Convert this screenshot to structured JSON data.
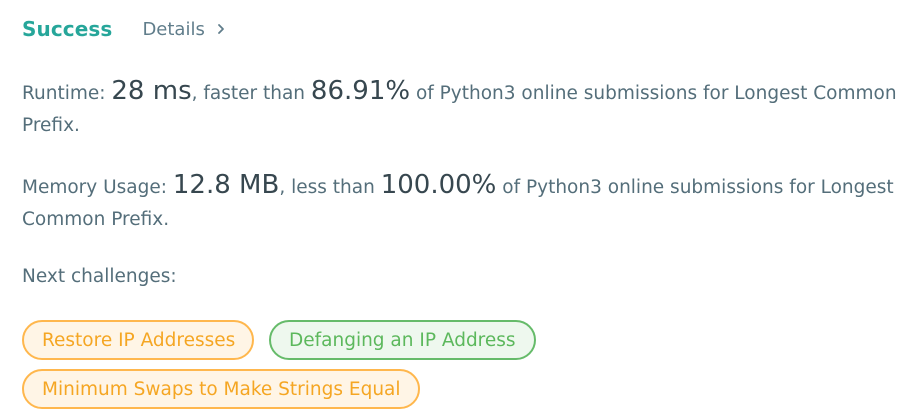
{
  "header": {
    "status": "Success",
    "details_label": "Details"
  },
  "runtime": {
    "label": "Runtime: ",
    "value": "28 ms",
    "comparison": ", faster than ",
    "percent": "86.91%",
    "suffix": " of Python3 online submissions for Longest Common Prefix."
  },
  "memory": {
    "label": "Memory Usage: ",
    "value": "12.8 MB",
    "comparison": ", less than ",
    "percent": "100.00%",
    "suffix": " of Python3 online submissions for Longest Common Prefix."
  },
  "next": {
    "label": "Next challenges:",
    "challenges": [
      {
        "title": "Restore IP Addresses",
        "difficulty": "medium",
        "color": "#ffb74d"
      },
      {
        "title": "Defanging an IP Address",
        "difficulty": "easy",
        "color": "#66bb6a"
      },
      {
        "title": "Minimum Swaps to Make Strings Equal",
        "difficulty": "medium",
        "color": "#ffb74d"
      }
    ]
  },
  "colors": {
    "success": "#26a69a",
    "medium_tag": "#ffb74d",
    "easy_tag": "#66bb6a"
  },
  "icons": {
    "details_chevron": "chevron-right-icon"
  }
}
